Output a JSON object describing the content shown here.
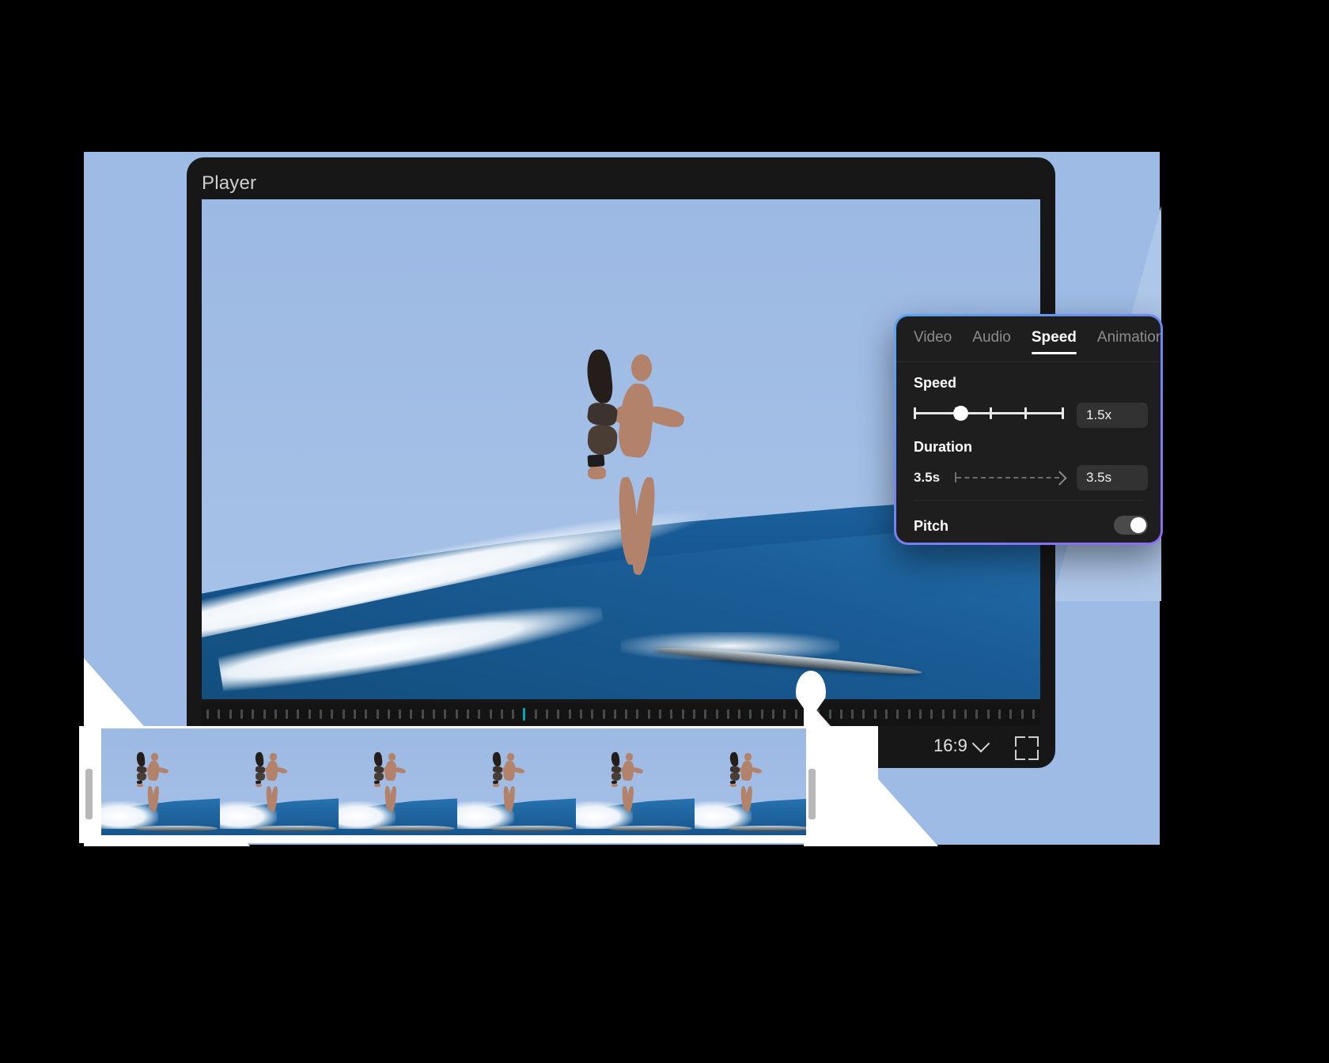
{
  "app": {
    "player_title": "Player"
  },
  "player_controls": {
    "aspect_ratio": "16:9",
    "aspect_chevron_icon": "chevron-down-icon",
    "fullscreen_icon": "fullscreen-icon"
  },
  "speed_panel": {
    "tabs": [
      {
        "label": "Video",
        "active": false
      },
      {
        "label": "Audio",
        "active": false
      },
      {
        "label": "Speed",
        "active": true
      },
      {
        "label": "Animation",
        "active": false
      }
    ],
    "speed": {
      "label": "Speed",
      "value": "1.5x",
      "slider_position_pct": 29,
      "tick_count": 6
    },
    "duration": {
      "label": "Duration",
      "from": "3.5s",
      "value": "3.5s"
    },
    "pitch": {
      "label": "Pitch",
      "enabled": true
    },
    "accent_gradient": [
      "#59a6f0",
      "#6f86f2",
      "#8d6bf0"
    ]
  },
  "timeline": {
    "playhead_marker": "playhead",
    "ruler_accent_color": "#00a7b5",
    "frame_count": 6,
    "trim_handle_left": "trim-handle-left",
    "trim_handle_right": "trim-handle-right"
  },
  "theme": {
    "background": "#000000",
    "panel_bg": "#1e1e1e",
    "shell_bg": "#171717",
    "backdrop_blue": "#9dbbe4"
  }
}
